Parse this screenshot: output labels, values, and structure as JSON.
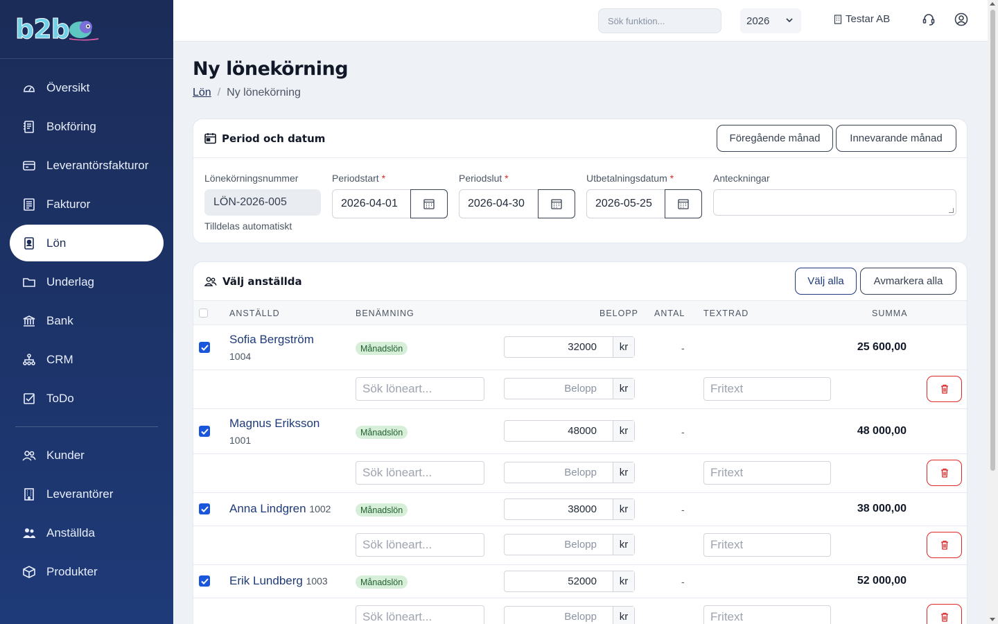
{
  "brand": {
    "logo_text": "b2b"
  },
  "sidebar": {
    "items": [
      {
        "label": "Översikt",
        "icon": "dashboard-icon",
        "active": false
      },
      {
        "label": "Bokföring",
        "icon": "ledger-icon",
        "active": false
      },
      {
        "label": "Leverantörsfakturor",
        "icon": "credit-card-icon",
        "active": false
      },
      {
        "label": "Fakturor",
        "icon": "invoice-icon",
        "active": false
      },
      {
        "label": "Lön",
        "icon": "id-badge-icon",
        "active": true
      },
      {
        "label": "Underlag",
        "icon": "folder-icon",
        "active": false
      },
      {
        "label": "Bank",
        "icon": "bank-icon",
        "active": false
      },
      {
        "label": "CRM",
        "icon": "org-chart-icon",
        "active": false
      },
      {
        "label": "ToDo",
        "icon": "checkbox-icon",
        "active": false
      }
    ],
    "items2": [
      {
        "label": "Kunder",
        "icon": "users-icon"
      },
      {
        "label": "Leverantörer",
        "icon": "building-icon"
      },
      {
        "label": "Anställda",
        "icon": "people-icon"
      },
      {
        "label": "Produkter",
        "icon": "box-icon"
      }
    ]
  },
  "topbar": {
    "search_placeholder": "Sök funktion...",
    "year": "2026",
    "company": "Testar AB"
  },
  "page": {
    "title": "Ny lönekörning",
    "breadcrumb": {
      "parent": "Lön",
      "sep": "/",
      "current": "Ny lönekörning"
    }
  },
  "period": {
    "title": "Period och datum",
    "prev_month_btn": "Föregående månad",
    "current_month_btn": "Innevarande månad",
    "run_number_label": "Lönekörningsnummer",
    "run_number": "LÖN-2026-005",
    "auto_note": "Tilldelas automatiskt",
    "start_label": "Periodstart",
    "start_value": "2026-04-01",
    "end_label": "Periodslut",
    "end_value": "2026-04-30",
    "payout_label": "Utbetalningsdatum",
    "payout_value": "2026-05-25",
    "notes_label": "Anteckningar",
    "required_mark": "*"
  },
  "employees": {
    "title": "Välj anställda",
    "select_all": "Välj alla",
    "deselect_all": "Avmarkera alla",
    "columns": {
      "employee": "ANSTÄLLD",
      "name": "BENÄMNING",
      "amount": "BELOPP",
      "qty": "ANTAL",
      "text": "TEXTRAD",
      "sum": "SUMMA"
    },
    "rows": [
      {
        "name": "Sofia Bergström",
        "id": "1004",
        "type": "Månadslön",
        "amount": "32000",
        "currency": "kr",
        "qty": "-",
        "sum": "25 600,00",
        "checked": true
      },
      {
        "name": "Magnus Eriksson",
        "id": "1001",
        "type": "Månadslön",
        "amount": "48000",
        "currency": "kr",
        "qty": "-",
        "sum": "48 000,00",
        "checked": true
      },
      {
        "name": "Anna Lindgren",
        "id": "1002",
        "type": "Månadslön",
        "amount": "38000",
        "currency": "kr",
        "qty": "-",
        "sum": "38 000,00",
        "checked": true
      },
      {
        "name": "Erik Lundberg",
        "id": "1003",
        "type": "Månadslön",
        "amount": "52000",
        "currency": "kr",
        "qty": "-",
        "sum": "52 000,00",
        "checked": true
      }
    ],
    "add_row": {
      "type_placeholder": "Sök löneart...",
      "amount_placeholder": "Belopp",
      "currency": "kr",
      "text_placeholder": "Fritext"
    }
  },
  "colors": {
    "sidebar": "#1b2c58",
    "accent": "#1e3a78",
    "danger": "#dc2626",
    "badge_bg": "#d7eed9"
  }
}
